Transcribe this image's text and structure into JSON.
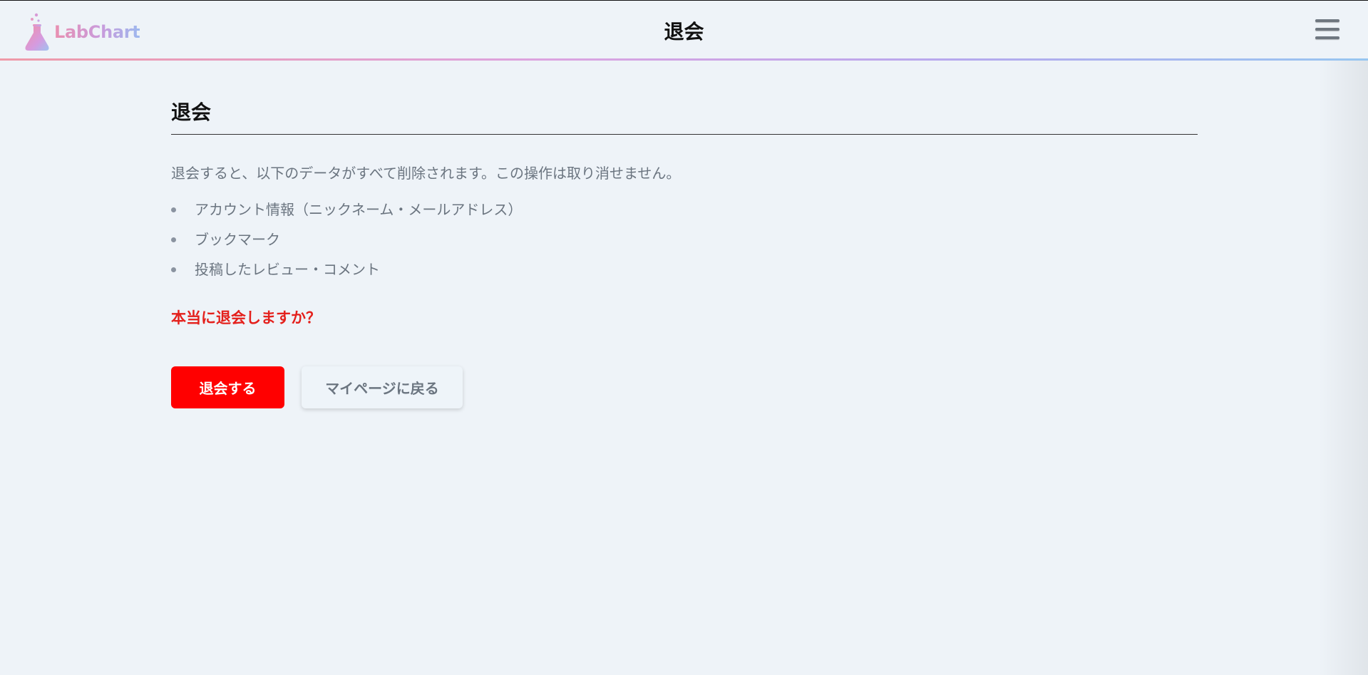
{
  "header": {
    "logo_text": "LabChart",
    "title": "退会",
    "menu_icon": "hamburger-menu-icon"
  },
  "main": {
    "title": "退会",
    "notice": "退会すると、以下のデータがすべて削除されます。この操作は取り消せません。",
    "deleted_items": [
      "アカウント情報（ニックネーム・メールアドレス）",
      "ブックマーク",
      "投稿したレビュー・コメント"
    ],
    "confirm_question": "本当に退会しますか？",
    "withdraw_button_label": "退会する",
    "back_button_label": "マイページに戻る"
  },
  "colors": {
    "background": "#eef3f8",
    "danger": "#ff0000",
    "confirm_text": "#e4201c",
    "muted_text": "#6b7580"
  }
}
